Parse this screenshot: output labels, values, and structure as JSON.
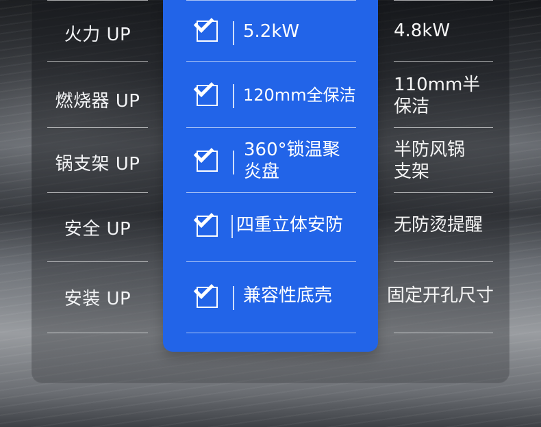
{
  "comparison": {
    "rows": [
      {
        "left_label": "火力 UP",
        "middle_value": "5.2kW",
        "right_value": "4.8kW"
      },
      {
        "left_label": "燃烧器 UP",
        "middle_value": "120mm全保洁",
        "right_value": "110mm半\n保洁"
      },
      {
        "left_label": "锅支架 UP",
        "middle_value": "360°锁温聚\n炎盘",
        "right_value": "半防风锅\n支架"
      },
      {
        "left_label": "安全 UP",
        "middle_value": "四重立体安防",
        "right_value": "无防烫提醒"
      },
      {
        "left_label": "安装 UP",
        "middle_value": "兼容性底壳",
        "right_value": "固定开孔尺寸"
      }
    ]
  },
  "colors": {
    "highlight_blue": "#2264e8",
    "text_primary": "#ffffff",
    "divider": "#ffffff"
  },
  "icons": {
    "checkbox": "checkbox-checked-icon"
  }
}
